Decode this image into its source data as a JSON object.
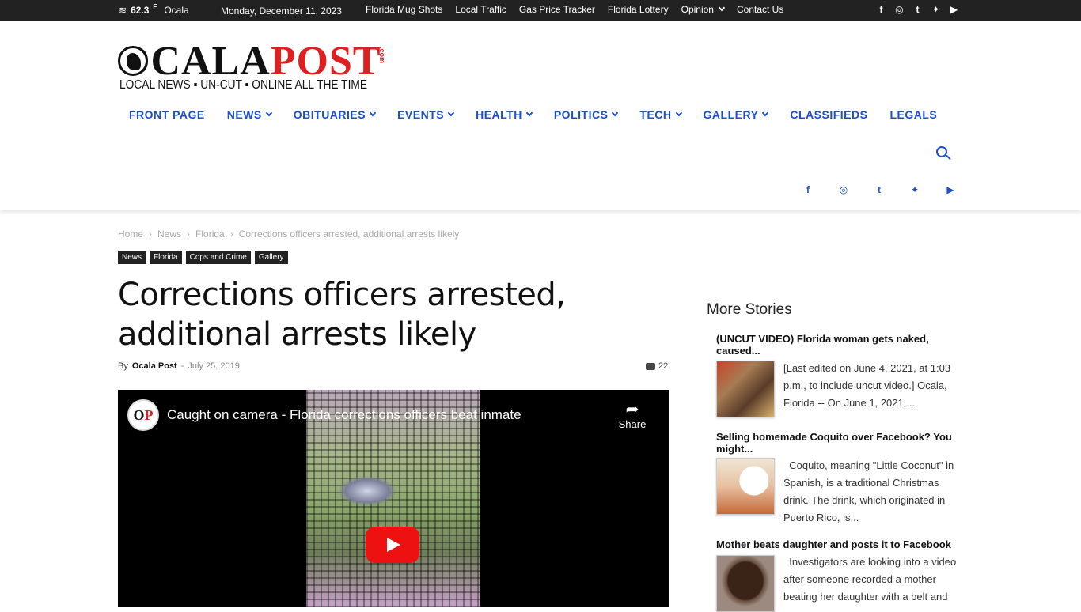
{
  "topbar": {
    "temp": "62.3",
    "unit": "F",
    "location": "Ocala",
    "date": "Monday, December 11, 2023",
    "links": [
      "Florida Mug Shots",
      "Local Traffic",
      "Gas Price Tracker",
      "Florida Lottery",
      "Opinion",
      "Contact Us"
    ]
  },
  "logo": {
    "ocala": "OCALA",
    "post": "POST",
    "dotcom": ".com",
    "tagline": "LOCAL NEWS ▪ UN-CUT ▪ ONLINE ALL THE TIME"
  },
  "nav": {
    "items": [
      {
        "label": "FRONT PAGE",
        "dropdown": false
      },
      {
        "label": "NEWS",
        "dropdown": true
      },
      {
        "label": "OBITUARIES",
        "dropdown": true
      },
      {
        "label": "EVENTS",
        "dropdown": true
      },
      {
        "label": "HEALTH",
        "dropdown": true
      },
      {
        "label": "POLITICS",
        "dropdown": true
      },
      {
        "label": "TECH",
        "dropdown": true
      },
      {
        "label": "GALLERY",
        "dropdown": true
      },
      {
        "label": "CLASSIFIEDS",
        "dropdown": false
      },
      {
        "label": "LEGALS",
        "dropdown": false
      }
    ]
  },
  "social_icons": [
    "facebook-icon",
    "instagram-icon",
    "tumblr-icon",
    "twitter-icon",
    "youtube-icon"
  ],
  "breadcrumb": [
    "Home",
    "News",
    "Florida",
    "Corrections officers arrested, additional arrests likely"
  ],
  "tags": [
    "News",
    "Florida",
    "Cops and Crime",
    "Gallery"
  ],
  "article": {
    "title": "Corrections officers arrested, additional arrests likely",
    "by": "By",
    "author": "Ocala Post",
    "dash": "-",
    "date": "July 25, 2019",
    "comments": "22"
  },
  "video": {
    "title": "Caught on camera - Florida corrections officers beat inmate",
    "share_label": "Share"
  },
  "sidebar": {
    "title": "More Stories",
    "stories": [
      {
        "title": "(UNCUT VIDEO) Florida woman gets naked, caused...",
        "excerpt": "[Last edited on June 4, 2021, at 1:03 p.m., to include uncut video.] Ocala, Florida -- On June 1, 2021,..."
      },
      {
        "title": "Selling homemade Coquito over Facebook? You might...",
        "excerpt": "  Coquito, meaning \"Little Coconut\" in Spanish, is a traditional Christmas drink. The drink, which originated in Puerto Rico, is..."
      },
      {
        "title": "Mother beats daughter and posts it to Facebook",
        "excerpt": "  Investigators are looking into a video after someone recorded a mother beating her daughter with a belt and"
      }
    ]
  },
  "colors": {
    "nav_blue": "#1b4fcf",
    "brand_red": "#e02020",
    "topbar_bg": "#222222"
  }
}
